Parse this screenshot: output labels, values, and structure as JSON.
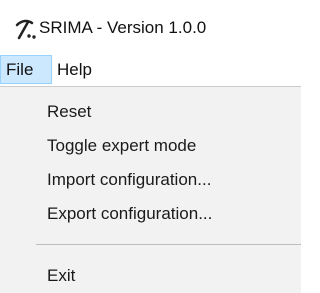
{
  "window": {
    "title": "SRIMA - Version 1.0.0",
    "icon": "pickaxe-icon"
  },
  "menu_bar": {
    "items": [
      {
        "label": "File",
        "state": "open"
      },
      {
        "label": "Help"
      }
    ]
  },
  "file_menu": {
    "items": [
      {
        "label": "Reset"
      },
      {
        "label": "Toggle expert mode"
      },
      {
        "label": "Import configuration..."
      },
      {
        "label": "Export configuration..."
      },
      {
        "label": "Exit"
      }
    ]
  },
  "colors": {
    "active_menu_background": "#cce8ff",
    "active_menu_border": "#99d1ff",
    "dropdown_background": "#f2f2f2",
    "separator": "#bdbdbd"
  }
}
